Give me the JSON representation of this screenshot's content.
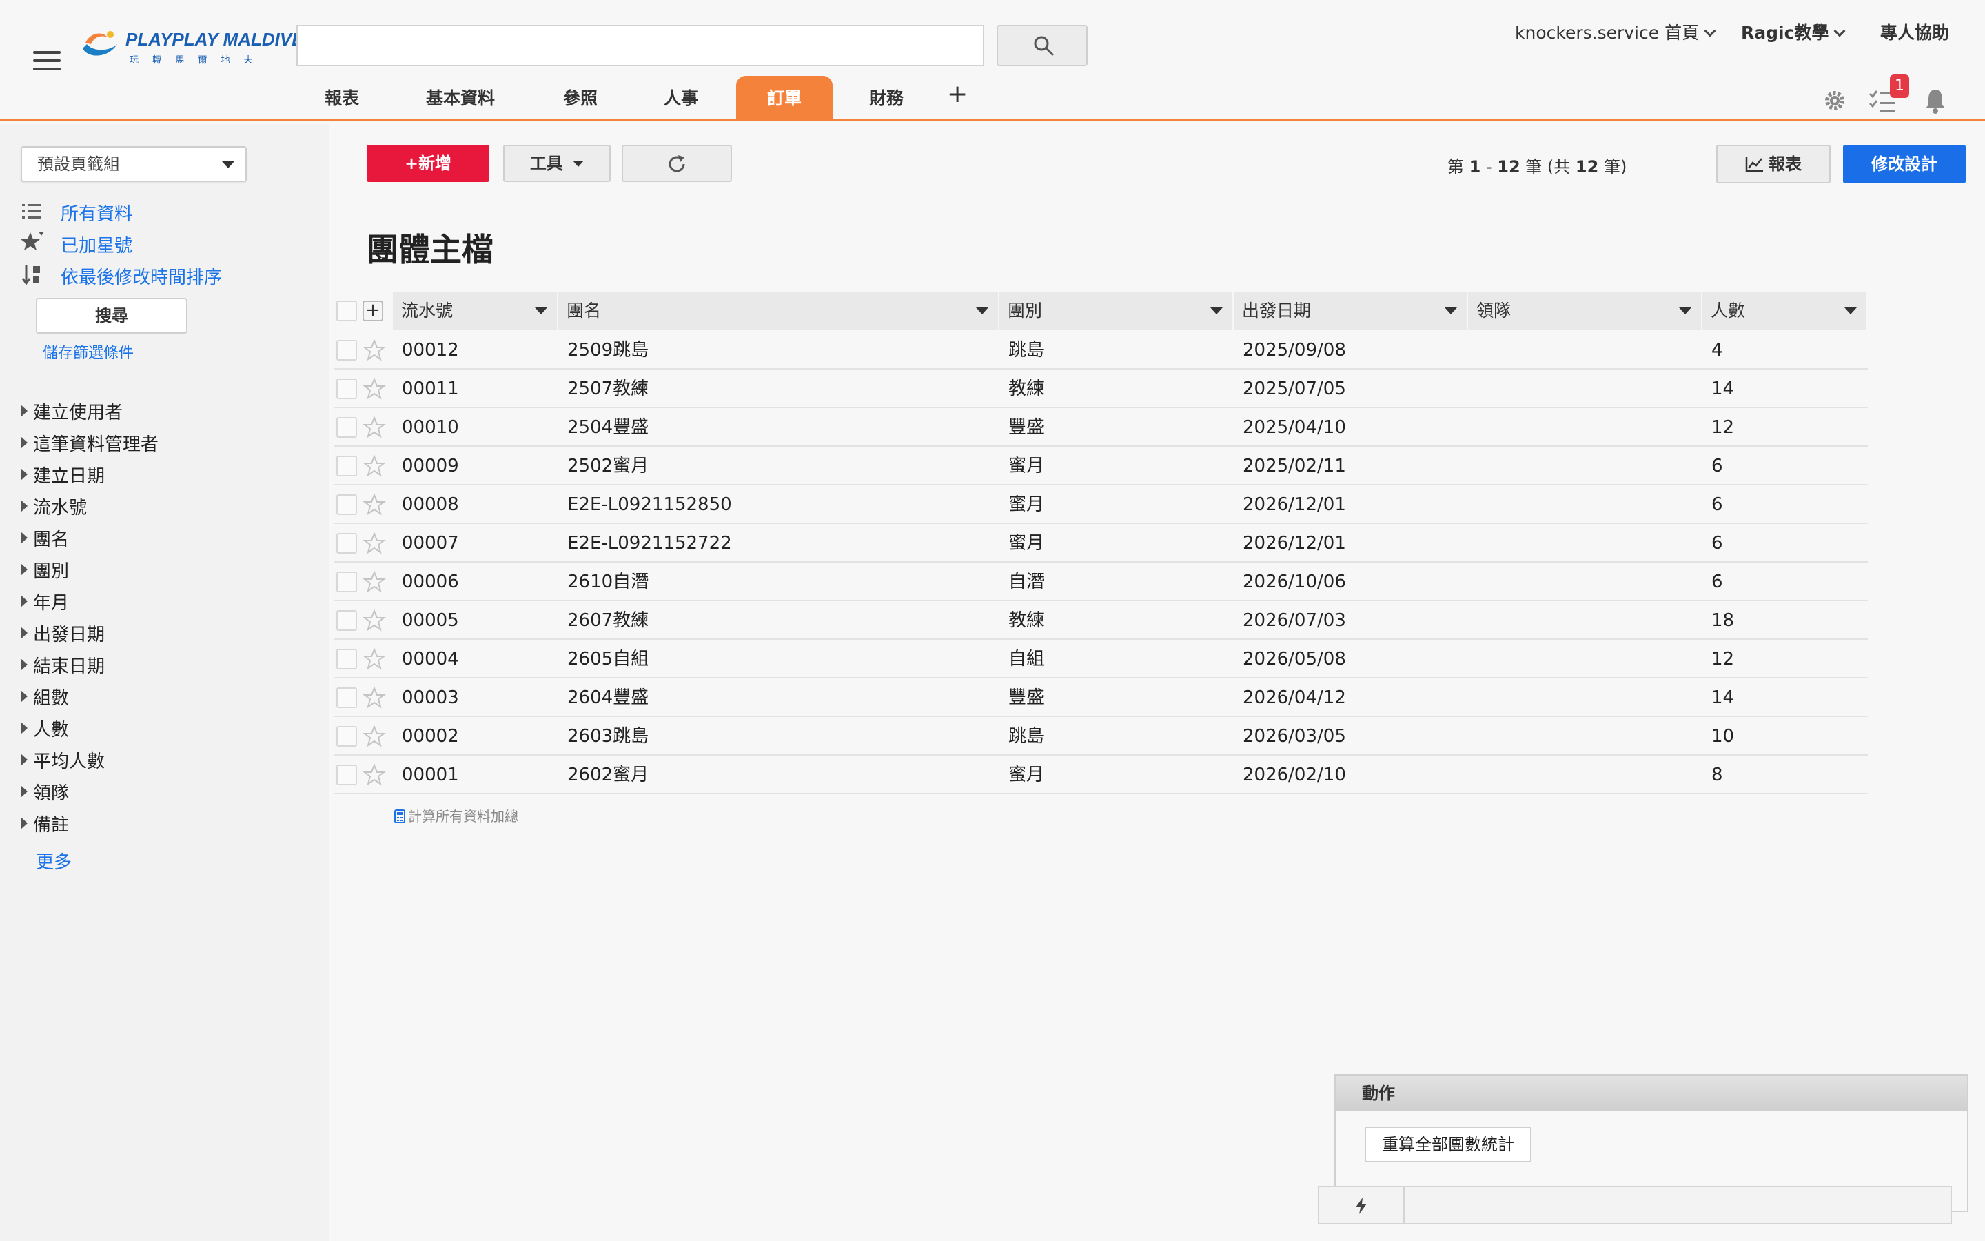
{
  "header": {
    "logo_text": "PLAYPLAY MALDIVES",
    "logo_subtext": "玩 轉 馬 爾 地 夫",
    "search_placeholder": "",
    "user_menu": "knockers.service 首頁",
    "ragic_menu": "Ragic教學",
    "help_link": "專人協助",
    "task_badge": "1",
    "icons": [
      "hamburger-icon",
      "search-icon",
      "gear-icon",
      "tasks-icon",
      "bell-icon"
    ]
  },
  "tabs": [
    {
      "label": "報表",
      "active": false
    },
    {
      "label": "基本資料",
      "active": false
    },
    {
      "label": "參照",
      "active": false
    },
    {
      "label": "人事",
      "active": false
    },
    {
      "label": "訂單",
      "active": true
    },
    {
      "label": "財務",
      "active": false
    }
  ],
  "tab_add": "+",
  "sidebar": {
    "tabgroup_select": "預設頁籤組",
    "links": [
      {
        "label": "所有資料",
        "icon": "list-icon"
      },
      {
        "label": "已加星號",
        "icon": "star-icon"
      },
      {
        "label": "依最後修改時間排序",
        "icon": "sort-icon"
      }
    ],
    "search_button": "搜尋",
    "save_filter": "儲存篩選條件",
    "filters": [
      "建立使用者",
      "這筆資料管理者",
      "建立日期",
      "流水號",
      "團名",
      "團別",
      "年月",
      "出發日期",
      "結束日期",
      "組數",
      "人數",
      "平均人數",
      "領隊",
      "備註"
    ],
    "more": "更多"
  },
  "toolbar": {
    "new_label": "+新增",
    "tools_label": "工具",
    "record_range_prefix": "第 ",
    "record_from": "1",
    "record_sep": " - ",
    "record_to": "12",
    "record_mid": " 筆 (共 ",
    "record_total": "12",
    "record_suffix": " 筆)",
    "report_label": "報表",
    "edit_design_label": "修改設計"
  },
  "page_title": "團體主檔",
  "table": {
    "columns": [
      "流水號",
      "團名",
      "團別",
      "出發日期",
      "領隊",
      "人數"
    ],
    "rows": [
      [
        "00012",
        "2509跳島",
        "跳島",
        "2025/09/08",
        "",
        "4"
      ],
      [
        "00011",
        "2507教練",
        "教練",
        "2025/07/05",
        "",
        "14"
      ],
      [
        "00010",
        "2504豐盛",
        "豐盛",
        "2025/04/10",
        "",
        "12"
      ],
      [
        "00009",
        "2502蜜月",
        "蜜月",
        "2025/02/11",
        "",
        "6"
      ],
      [
        "00008",
        "E2E-L0921152850",
        "蜜月",
        "2026/12/01",
        "",
        "6"
      ],
      [
        "00007",
        "E2E-L0921152722",
        "蜜月",
        "2026/12/01",
        "",
        "6"
      ],
      [
        "00006",
        "2610自潛",
        "自潛",
        "2026/10/06",
        "",
        "6"
      ],
      [
        "00005",
        "2607教練",
        "教練",
        "2026/07/03",
        "",
        "18"
      ],
      [
        "00004",
        "2605自組",
        "自組",
        "2026/05/08",
        "",
        "12"
      ],
      [
        "00003",
        "2604豐盛",
        "豐盛",
        "2026/04/12",
        "",
        "14"
      ],
      [
        "00002",
        "2603跳島",
        "跳島",
        "2026/03/05",
        "",
        "10"
      ],
      [
        "00001",
        "2602蜜月",
        "蜜月",
        "2026/02/10",
        "",
        "8"
      ]
    ],
    "sum_all": "計算所有資料加總"
  },
  "action_panel": {
    "title": "動作",
    "recalc_button": "重算全部團數統計"
  },
  "colors": {
    "accent_orange": "#f5823a",
    "new_red": "#e8173c",
    "primary_blue": "#1a6ee8",
    "link_blue": "#1a73e8",
    "badge_red": "#e63946"
  }
}
